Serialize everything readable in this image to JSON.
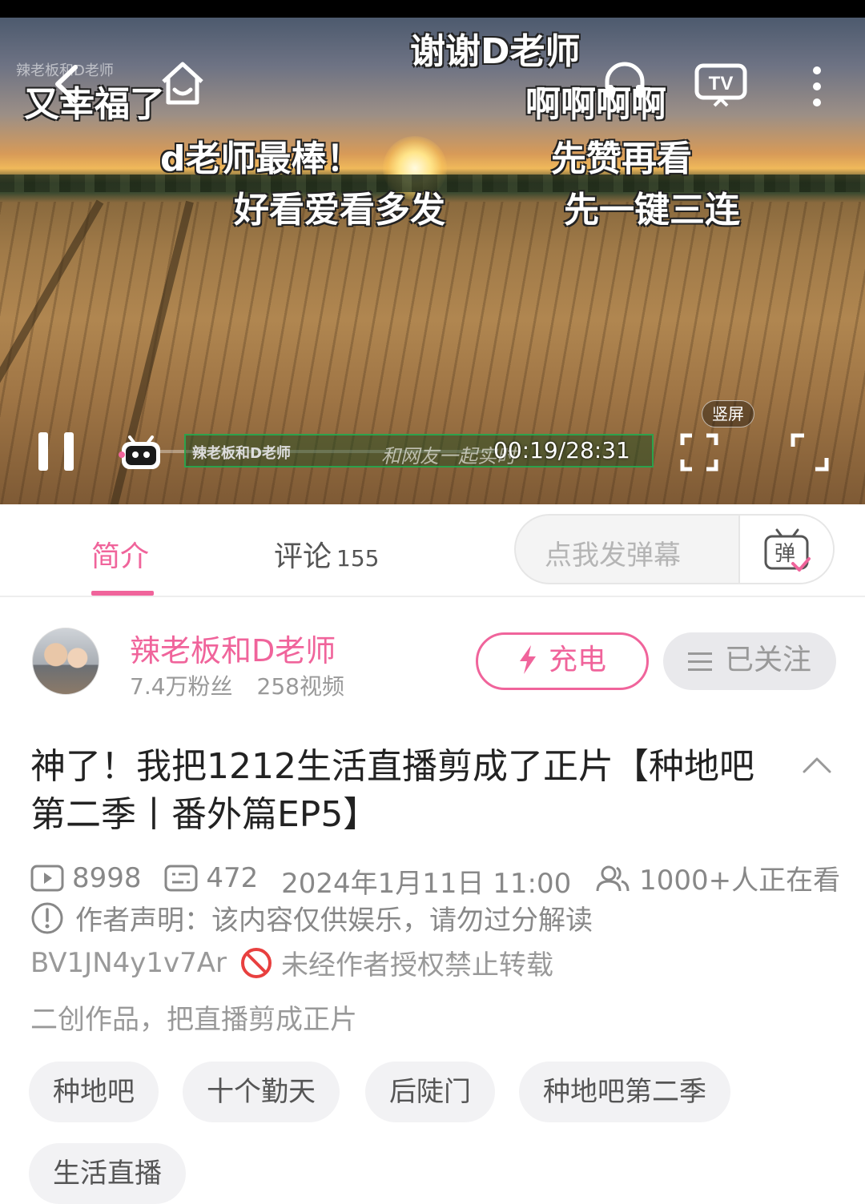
{
  "player": {
    "watermark": "辣老板和D老师",
    "danmaku": [
      {
        "text": "谢谢D老师"
      },
      {
        "text": "又幸福了"
      },
      {
        "text": "啊啊啊啊"
      },
      {
        "text": "d老师最棒！"
      },
      {
        "text": "先赞再看"
      },
      {
        "text": "好看爱看多发"
      },
      {
        "text": "先一键三连"
      }
    ],
    "progress_label": "辣老板和D老师",
    "progress_ghost": "和网友一起实时",
    "time": "00:19/28:31",
    "vertical_label": "竖屏",
    "progress_fraction": 0.011
  },
  "tabs": {
    "intro": "简介",
    "comments": "评论",
    "comments_count": "155",
    "danmaku_placeholder": "点我发弹幕"
  },
  "uploader": {
    "name": "辣老板和D老师",
    "fans": "7.4万粉丝",
    "videos": "258视频",
    "charge": "充电",
    "follow": "已关注"
  },
  "video": {
    "title": "神了！我把1212生活直播剪成了正片【种地吧第二季丨番外篇EP5】",
    "plays": "8998",
    "danmaku_count": "472",
    "date": "2024年1月11日 11:00",
    "watching": "1000+人正在看",
    "declaration": "作者声明：该内容仅供娱乐，请勿过分解读",
    "bvid": "BV1JN4y1v7Ar",
    "no_repost": "未经作者授权禁止转载",
    "description": "二创作品，把直播剪成正片"
  },
  "tags": [
    "种地吧",
    "十个勤天",
    "后陡门",
    "种地吧第二季",
    "生活直播"
  ],
  "colors": {
    "accent": "#f0649b",
    "muted": "#999999"
  }
}
